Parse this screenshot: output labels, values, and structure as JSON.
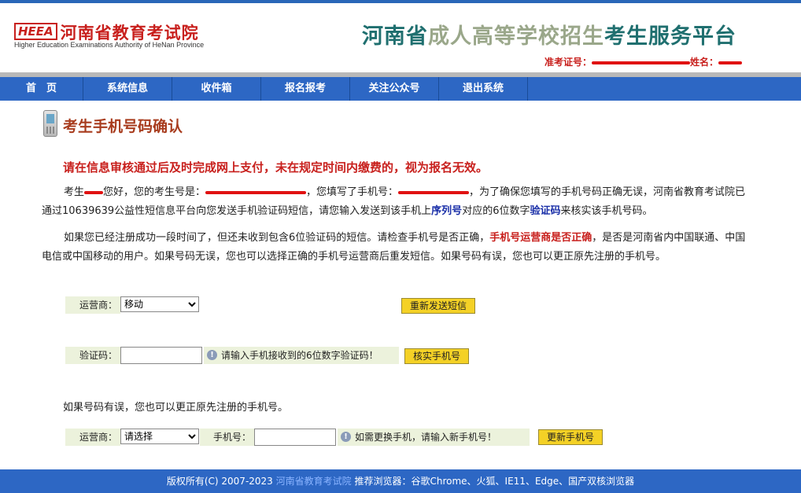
{
  "header": {
    "logo_badge": "HEEA",
    "logo_title": "河南省教育考试院",
    "logo_subtitle": "Higher Education Examinations Authority of HeNan Province",
    "platform_title_a": "河南省",
    "platform_title_b": "成人高等学校招生",
    "platform_title_c": "考生服务平台",
    "exam_no_label": "准考证号：",
    "name_label": "姓名："
  },
  "nav": {
    "items": [
      {
        "label": "首　页"
      },
      {
        "label": "系统信息"
      },
      {
        "label": "收件箱"
      },
      {
        "label": "报名报考"
      },
      {
        "label": "关注公众号"
      },
      {
        "label": "退出系统"
      }
    ]
  },
  "page": {
    "title": "考生手机号码确认",
    "warning": "请在信息审核通过后及时完成网上支付，未在规定时间内缴费的，视为报名无效。",
    "p1_a": "考生",
    "p1_b": "您好，您的考生号是：",
    "p1_c": "，您填写了手机号：",
    "p1_d": "，为了确保您填写的手机号码正确无误，河南省教育考试院已通过10639639公益性短信息平台向您发送手机验证码短信，请您输入发送到该手机上",
    "p1_serial": "序列号",
    "p1_e": "对应的6位数字",
    "p1_code": "验证码",
    "p1_f": "来核实该手机号码。",
    "p2_a": "如果您已经注册成功一段时间了，但还未收到包含6位验证码的短信。请检查手机号是否正确，",
    "p2_red": "手机号运营商是否正确",
    "p2_b": "，是否是河南省内中国联通、中国电信或中国移动的用户。如果号码无误，您也可以选择正确的手机号运营商后重发短信。如果号码有误，您也可以更正原先注册的手机号。",
    "note": "如果号码有误，您也可以更正原先注册的手机号。"
  },
  "form1": {
    "carrier_label": "运营商：",
    "carrier_value": "移动",
    "resend_button": "重新发送短信"
  },
  "form2": {
    "code_label": "验证码：",
    "code_value": "",
    "hint": "请输入手机接收到的6位数字验证码！",
    "verify_button": "核实手机号"
  },
  "form3": {
    "carrier_label": "运营商：",
    "carrier_value": "请选择",
    "phone_label": "手机号：",
    "phone_value": "",
    "hint": "如需更换手机，请输入新手机号！",
    "update_button": "更新手机号"
  },
  "footer": {
    "copyright": "版权所有(C) 2007-2023",
    "org_link": "河南省教育考试院",
    "browsers": "推荐浏览器：谷歌Chrome、火狐、IE11、Edge、国产双核浏览器"
  },
  "colors": {
    "nav_bg": "#2d67c4",
    "accent_red": "#c8201d",
    "button_yellow": "#f4d126",
    "label_bg": "#ecf2dc"
  }
}
